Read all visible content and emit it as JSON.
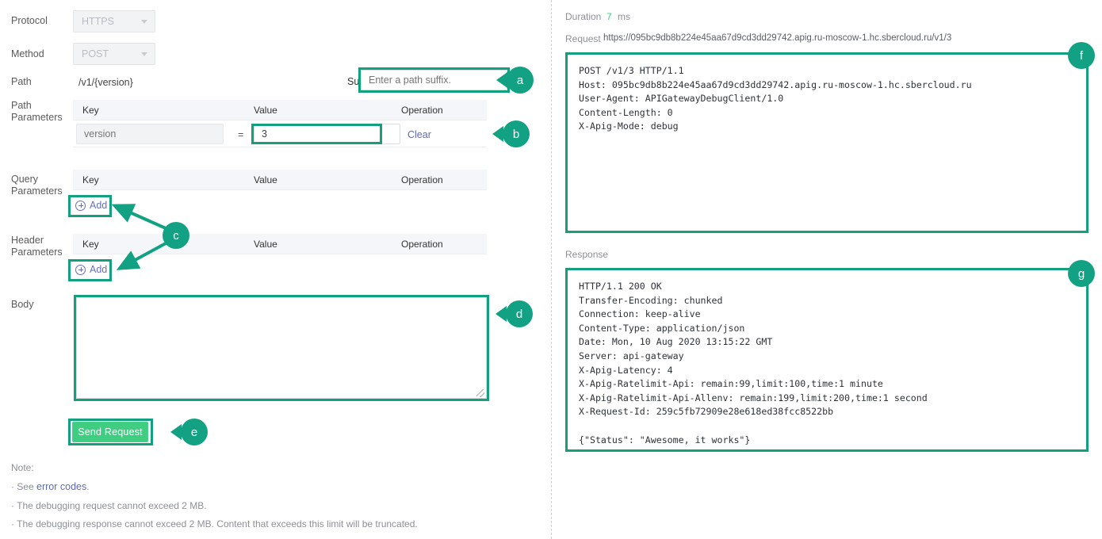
{
  "left": {
    "labels": {
      "protocol": "Protocol",
      "method": "Method",
      "path": "Path",
      "path_parameters": "Path\nParameters",
      "path_parameters_l1": "Path",
      "path_parameters_l2": "Parameters",
      "query_parameters_l1": "Query",
      "query_parameters_l2": "Parameters",
      "header_parameters_l1": "Header",
      "header_parameters_l2": "Parameters",
      "body": "Body",
      "suffix": "Suffix"
    },
    "protocol_value": "HTTPS",
    "method_value": "POST",
    "path_value": "/v1/{version}",
    "suffix_placeholder": "Enter a path suffix.",
    "suffix_value": "",
    "table_headers": {
      "key": "Key",
      "value": "Value",
      "operation": "Operation"
    },
    "path_param_row": {
      "key_placeholder": "version",
      "equals": "=",
      "value": "3",
      "operation": "Clear"
    },
    "add_label": "Add",
    "body_value": "",
    "send_button": "Send Request",
    "note": {
      "title": "Note:",
      "items": [
        {
          "prefix": "· See ",
          "link": "error codes",
          "suffix": "."
        },
        {
          "prefix": "· The debugging request cannot exceed 2 MB.",
          "link": "",
          "suffix": ""
        },
        {
          "prefix": "· The debugging response cannot exceed 2 MB. Content that exceeds this limit will be truncated.",
          "link": "",
          "suffix": ""
        }
      ]
    }
  },
  "right": {
    "duration_label": "Duration",
    "duration_value": "7",
    "duration_unit": "ms",
    "request_label": "Request",
    "request_url": "https://095bc9db8b224e45aa67d9cd3dd29742.apig.ru-moscow-1.hc.sbercloud.ru/v1/3",
    "request_body": "POST /v1/3 HTTP/1.1\nHost: 095bc9db8b224e45aa67d9cd3dd29742.apig.ru-moscow-1.hc.sbercloud.ru\nUser-Agent: APIGatewayDebugClient/1.0\nContent-Length: 0\nX-Apig-Mode: debug",
    "response_label": "Response",
    "response_body": "HTTP/1.1 200 OK\nTransfer-Encoding: chunked\nConnection: keep-alive\nContent-Type: application/json\nDate: Mon, 10 Aug 2020 13:15:22 GMT\nServer: api-gateway\nX-Apig-Latency: 4\nX-Apig-Ratelimit-Api: remain:99,limit:100,time:1 minute\nX-Apig-Ratelimit-Api-Allenv: remain:199,limit:200,time:1 second\nX-Request-Id: 259c5fb72909e28e618ed38fcc8522bb\n\n{\"Status\": \"Awesome, it works\"}"
  },
  "annotations": {
    "a": "a",
    "b": "b",
    "c": "c",
    "d": "d",
    "e": "e",
    "f": "f",
    "g": "g"
  },
  "colors": {
    "accent_teal": "#12a283",
    "highlight_border": "#14a07e",
    "button_green": "#3fcd82",
    "link_purple": "#6470bf",
    "duration_green": "#3fcd82"
  }
}
